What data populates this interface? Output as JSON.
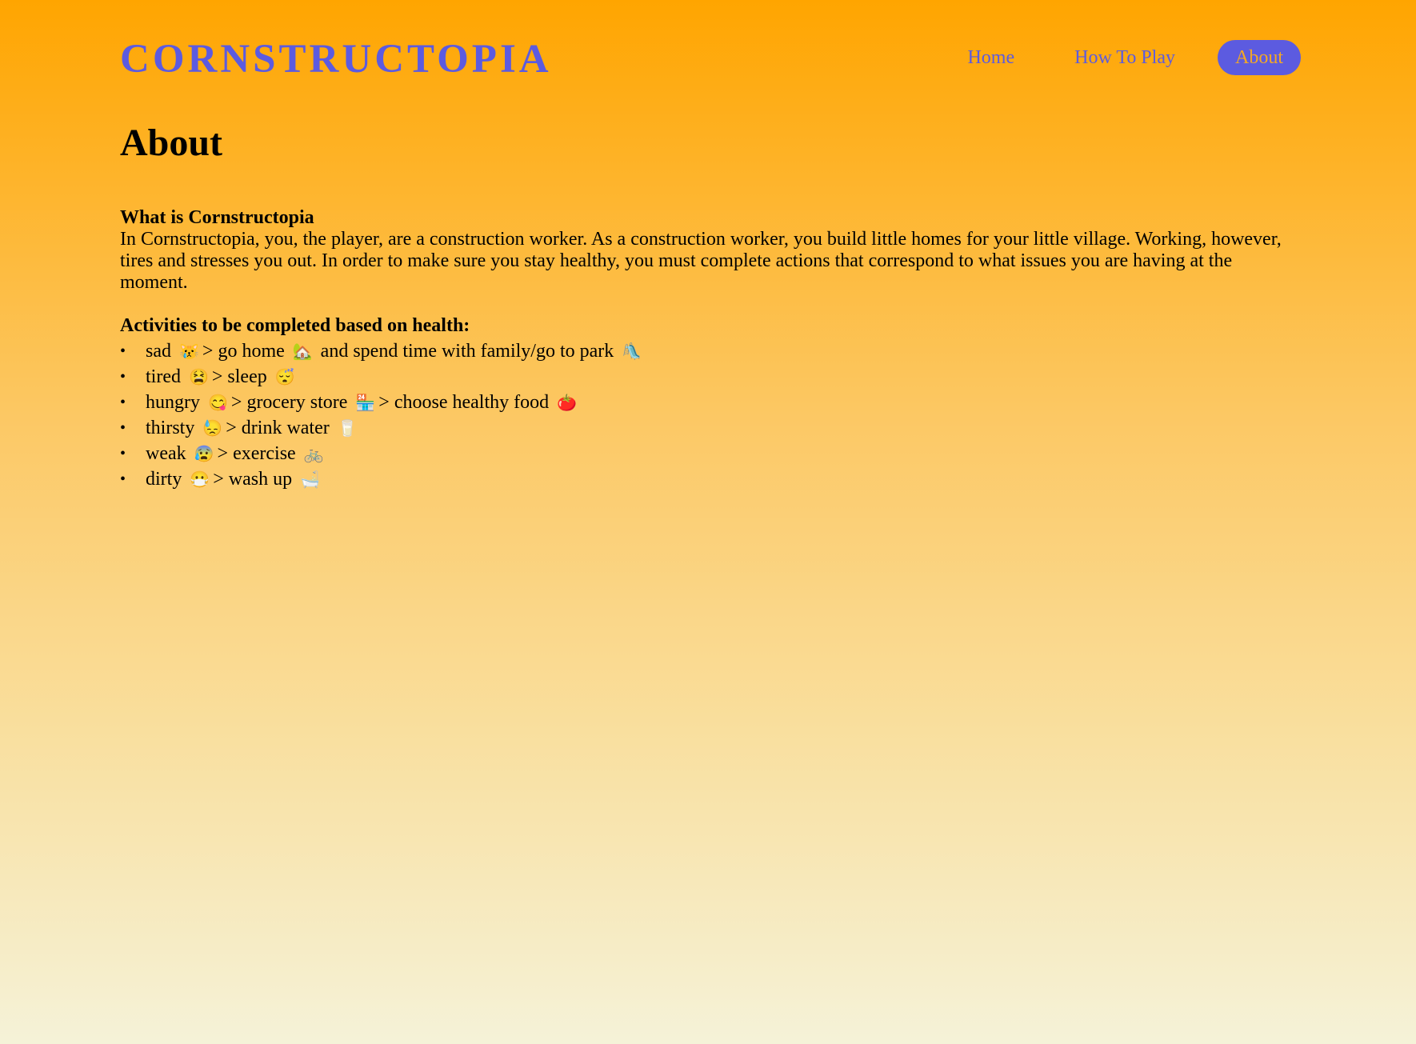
{
  "header": {
    "logo": "CORNSTRUCTOPIA",
    "nav": [
      {
        "label": "Home",
        "active": false
      },
      {
        "label": "How To Play",
        "active": false
      },
      {
        "label": "About",
        "active": true
      }
    ]
  },
  "page": {
    "title": "About"
  },
  "about": {
    "heading": "What is Cornstructopia",
    "body": "In Cornstructopia, you, the player, are a construction worker. As a construction worker, you build little homes for your little village. Working, however, tires and stresses you out. In order to make sure you stay healthy, you must complete actions that correspond to what issues you are having at the moment."
  },
  "activities": {
    "heading": "Activities to be completed based on health:",
    "items": [
      {
        "parts": [
          "sad",
          "😿",
          "> go home",
          "🏡",
          "and spend time with family/go to park",
          "🛝"
        ]
      },
      {
        "parts": [
          "tired",
          "😫",
          "> sleep",
          "😴"
        ]
      },
      {
        "parts": [
          "hungry",
          "😋",
          "> grocery store",
          "🏪",
          "> choose healthy food",
          "🍅"
        ]
      },
      {
        "parts": [
          "thirsty",
          "😓",
          "> drink water",
          "🥛"
        ]
      },
      {
        "parts": [
          "weak",
          "😰",
          "> exercise",
          "🚲"
        ]
      },
      {
        "parts": [
          "dirty",
          "😷",
          "> wash up",
          "🛁"
        ]
      }
    ]
  },
  "colors": {
    "accent": "#5c5be0",
    "active_nav_text": "#f4a823",
    "gradient_top": "#ffa500",
    "gradient_bottom": "#f5f2d8"
  }
}
